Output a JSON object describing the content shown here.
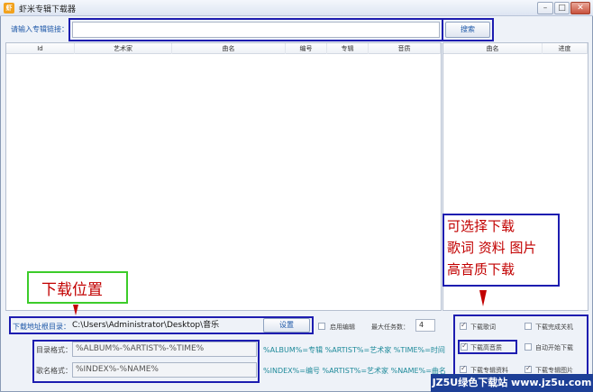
{
  "window": {
    "title": "虾米专辑下载器",
    "app_icon_text": "虾"
  },
  "window_controls": {
    "minimize": "–",
    "maximize": "□",
    "close": "✕"
  },
  "search": {
    "label": "请输入专辑链接：",
    "value": "",
    "button": "搜索"
  },
  "main_table": {
    "columns": [
      "Id",
      "艺术家",
      "曲名",
      "编号",
      "专辑",
      "音质"
    ]
  },
  "download_table": {
    "columns": [
      "曲名",
      "进度"
    ]
  },
  "annotation_features": {
    "lines": [
      "可选择下载",
      "歌词 资料 图片",
      "高音质下载"
    ]
  },
  "annotation_location": {
    "text": "下载位置"
  },
  "download_dir": {
    "label": "下载地址根目录：",
    "value": "C:\\Users\\Administrator\\Desktop\\音乐",
    "button": "设置"
  },
  "options": {
    "enable_edit": "启用编辑",
    "max_tasks_label": "最大任务数：",
    "max_tasks_value": "4",
    "download_lyrics": "下载歌词",
    "shutdown_after": "下载完成关机",
    "download_hq": "下载高音质",
    "auto_start": "自动开始下载",
    "download_album_info": "下载专辑资料",
    "download_album_cover": "下载专辑图片"
  },
  "formats": {
    "dir_label": "目录格式：",
    "dir_value": "%ALBUM%-%ARTIST%-%TIME%",
    "dir_hint": "%ALBUM%=专辑 %ARTIST%=艺术家 %TIME%=时间",
    "name_label": "歌名格式：",
    "name_value": "%INDEX%-%NAME%",
    "name_hint": "%INDEX%=编号 %ARTIST%=艺术家 %NAME%=曲名"
  },
  "watermark": {
    "text": "JZ5U绿色下载站 www.jz5u.com"
  },
  "colors": {
    "annotation_blue": "#1d1db0",
    "annotation_green": "#3ccc2a",
    "annotation_red": "#c20000"
  }
}
